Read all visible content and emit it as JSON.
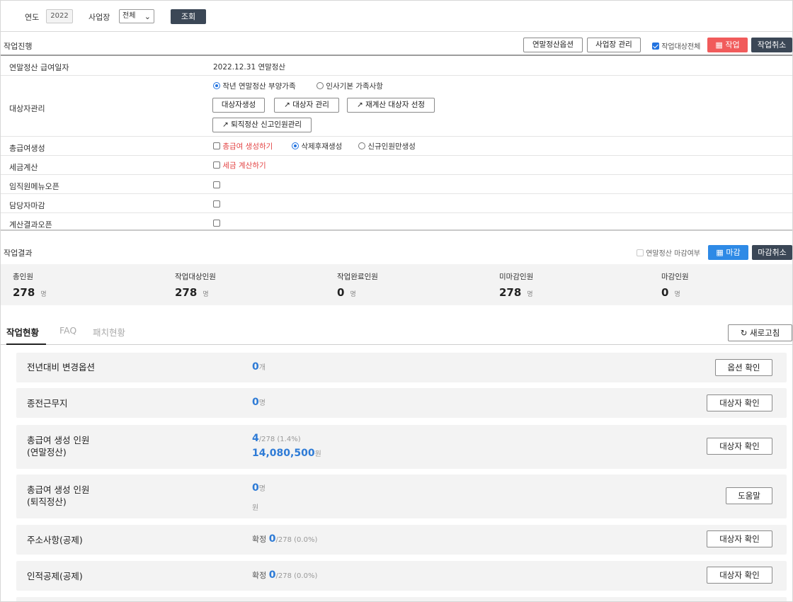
{
  "search": {
    "year_label": "연도",
    "year_value": "2022",
    "site_label": "사업장",
    "site_value": "전체",
    "query_button": "조회"
  },
  "progress": {
    "section_title": "작업진행",
    "buttons": {
      "settlement_options": "연말정산옵션",
      "site_manage": "사업장 관리",
      "all_targets_label": "작업대상전체",
      "run": "작업",
      "cancel": "작업취소"
    },
    "rows": {
      "pay_date": {
        "label": "연말정산 급여일자",
        "value": "2022.12.31 연말정산"
      },
      "targets": {
        "label": "대상자관리",
        "radio_prev": "작년 연말정산 부양가족",
        "radio_hr": "인사기본 가족사항",
        "btn_create": "대상자생성",
        "btn_manage": "대상자 관리",
        "btn_recalc": "재계산 대상자 선정",
        "btn_retire": "퇴직정산 신고인원관리"
      },
      "bonus": {
        "label": "총급여생성",
        "check_text": "총급여 생성하기",
        "radio_delete": "삭제후재생성",
        "radio_new": "신규인원만생성"
      },
      "tax": {
        "label": "세금계산",
        "check_text": "세금 계산하기"
      },
      "employee_open": {
        "label": "임직원메뉴오픈"
      },
      "manager_close": {
        "label": "담당자마감"
      },
      "result_open": {
        "label": "계산결과오픈"
      }
    }
  },
  "result": {
    "section_title": "작업결과",
    "close_flag_label": "연말정산 마감여부",
    "close_button": "마감",
    "close_cancel_button": "마감취소",
    "stats": [
      {
        "label": "총인원",
        "value": "278",
        "unit": "명"
      },
      {
        "label": "작업대상인원",
        "value": "278",
        "unit": "명"
      },
      {
        "label": "작업완료인원",
        "value": "0",
        "unit": "명"
      },
      {
        "label": "미마감인원",
        "value": "278",
        "unit": "명"
      },
      {
        "label": "마감인원",
        "value": "0",
        "unit": "명"
      }
    ]
  },
  "tabs": {
    "work_status": "작업현황",
    "faq": "FAQ",
    "patch": "패치현황",
    "refresh": "새로고침"
  },
  "cards": [
    {
      "title": "전년대비 변경옵션",
      "num": "0",
      "unit": "개",
      "button": "옵션 확인"
    },
    {
      "title": "종전근무지",
      "num": "0",
      "unit": "명",
      "button": "대상자 확인"
    },
    {
      "title1": "총급여 생성 인원",
      "title2": "(연말정산)",
      "num": "4",
      "extra": "/278 (1.4%)",
      "amount": "14,080,500",
      "amount_unit": "원",
      "button": "대상자 확인"
    },
    {
      "title1": "총급여 생성 인원",
      "title2": "(퇴직정산)",
      "num": "0",
      "unit": "명",
      "unit2": "원",
      "button": "도움말"
    },
    {
      "title": "주소사항(공제)",
      "prefix": "확정",
      "num": "0",
      "extra": "/278 (0.0%)",
      "button": "대상자 확인"
    },
    {
      "title": "인적공제(공제)",
      "prefix": "확정",
      "num": "0",
      "extra": "/278 (0.0%)",
      "button": "대상자 확인"
    }
  ]
}
